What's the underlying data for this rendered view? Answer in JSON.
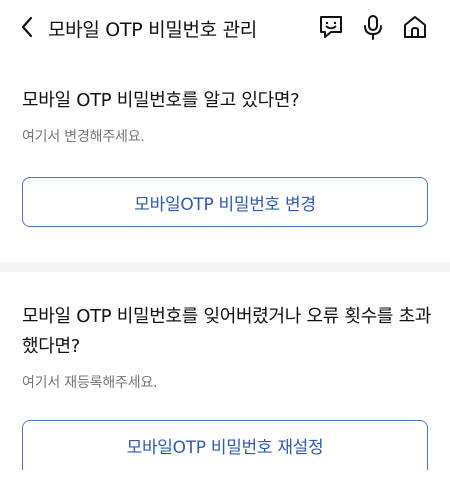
{
  "header": {
    "title": "모바일 OTP 비밀번호 관리",
    "back_icon": "chevron-left-icon",
    "icons": [
      "chat-icon",
      "mic-icon",
      "home-icon"
    ]
  },
  "section_change": {
    "title": "모바일 OTP 비밀번호를 알고 있다면?",
    "description": "여기서 변경해주세요.",
    "button_label": "모바일OTP 비밀번호 변경"
  },
  "section_reset": {
    "title_line1": "모바일 OTP 비밀번호를 잊어버렸거나 오류 횟수를 초과",
    "title_line2": "했다면?",
    "description": "여기서 재등록해주세요.",
    "button_label": "모바일OTP 비밀번호 재설정"
  },
  "colors": {
    "accent": "#2c5bb5",
    "button_border": "#4a78c8",
    "divider": "#f2f4f6",
    "muted_text": "#777777"
  }
}
